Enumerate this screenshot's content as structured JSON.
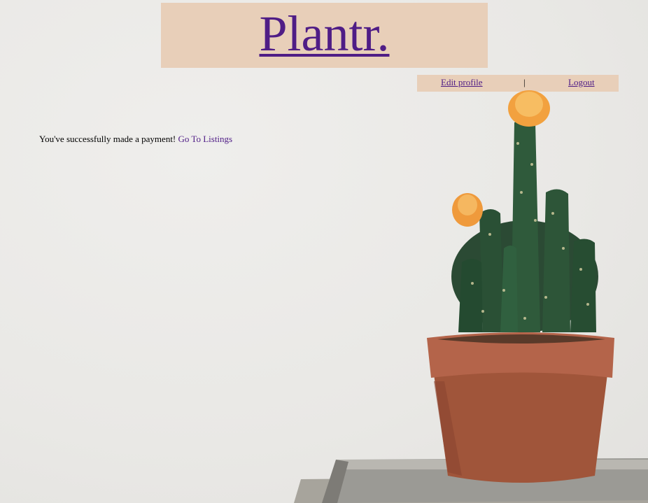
{
  "brand": {
    "logo_text": "Plantr."
  },
  "nav": {
    "edit_profile": "Edit profile",
    "separator": "|",
    "logout": "Logout"
  },
  "message": {
    "text": "You've successfully made a payment!",
    "link": "Go To Listings"
  },
  "colors": {
    "link": "#4f1d86",
    "header_bg": "#e8cfb9",
    "wall": "#ebeae7"
  }
}
